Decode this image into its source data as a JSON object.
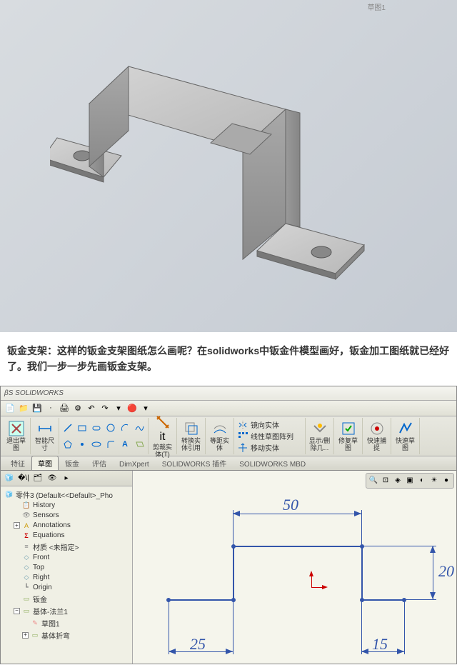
{
  "article": {
    "intro": "钣金支架：这样的钣金支架图纸怎么画呢？在solidworks中钣金件模型画好，钣金加工图纸就已经好了。我们一步一步先画钣金支架。"
  },
  "solidworks": {
    "title": "SOLIDWORKS",
    "tab_marker": "草图1",
    "qat_icons": [
      "new-icon",
      "open-icon",
      "save-icon",
      "print-icon",
      "undo râle-icon",
      "redo-icon",
      "options-icon",
      "rebuild-icon",
      "select-icon"
    ],
    "ribbon": {
      "exit": {
        "label": "退出草图"
      },
      "smart_dim": {
        "label": "智能尺寸"
      },
      "tools_small": [
        "line",
        "rect",
        "circle",
        "arc",
        "spline",
        "slot",
        "poly",
        "fillet",
        "point",
        "text",
        "plane",
        "trim"
      ],
      "trim": {
        "label": "剪裁实体(T)"
      },
      "convert": {
        "label": "转换实体引用"
      },
      "offset": {
        "label": "等距实体"
      },
      "mirror": {
        "label": "镜向实体"
      },
      "pattern": {
        "label": "线性草图阵列"
      },
      "move": {
        "label": "移动实体"
      },
      "display": {
        "label": "显示/删除几..."
      },
      "repair": {
        "label": "修复草图"
      },
      "quick_snap": {
        "label": "快速捕捉"
      },
      "rapid": {
        "label": "快速草图"
      }
    },
    "tabs": [
      "特征",
      "草图",
      "钣金",
      "评估",
      "DimXpert",
      "SOLIDWORKS 插件",
      "SOLIDWORKS MBD"
    ],
    "active_tab": 1,
    "tree": {
      "root": "零件3  (Default<<Default>_Pho",
      "items": [
        {
          "icon": "hist",
          "label": "History"
        },
        {
          "icon": "sensor",
          "label": "Sensors"
        },
        {
          "icon": "ann",
          "label": "Annotations",
          "expandable": true
        },
        {
          "icon": "eq",
          "label": "Equations"
        },
        {
          "icon": "mat",
          "label": "材质 <未指定>"
        },
        {
          "icon": "plane",
          "label": "Front"
        },
        {
          "icon": "plane",
          "label": "Top"
        },
        {
          "icon": "plane",
          "label": "Right"
        },
        {
          "icon": "orig",
          "label": "Origin"
        },
        {
          "icon": "sm",
          "label": "钣金"
        },
        {
          "icon": "sm",
          "label": "基体-法兰1",
          "expandable": true,
          "expanded": true
        },
        {
          "icon": "sk",
          "label": "草图1",
          "indent": 2
        },
        {
          "icon": "sm",
          "label": "基体折弯",
          "indent": 2,
          "expandable": true
        }
      ]
    },
    "sketch": {
      "dim1": "50",
      "dim2": "20",
      "dim3": "25",
      "dim4": "15"
    }
  }
}
